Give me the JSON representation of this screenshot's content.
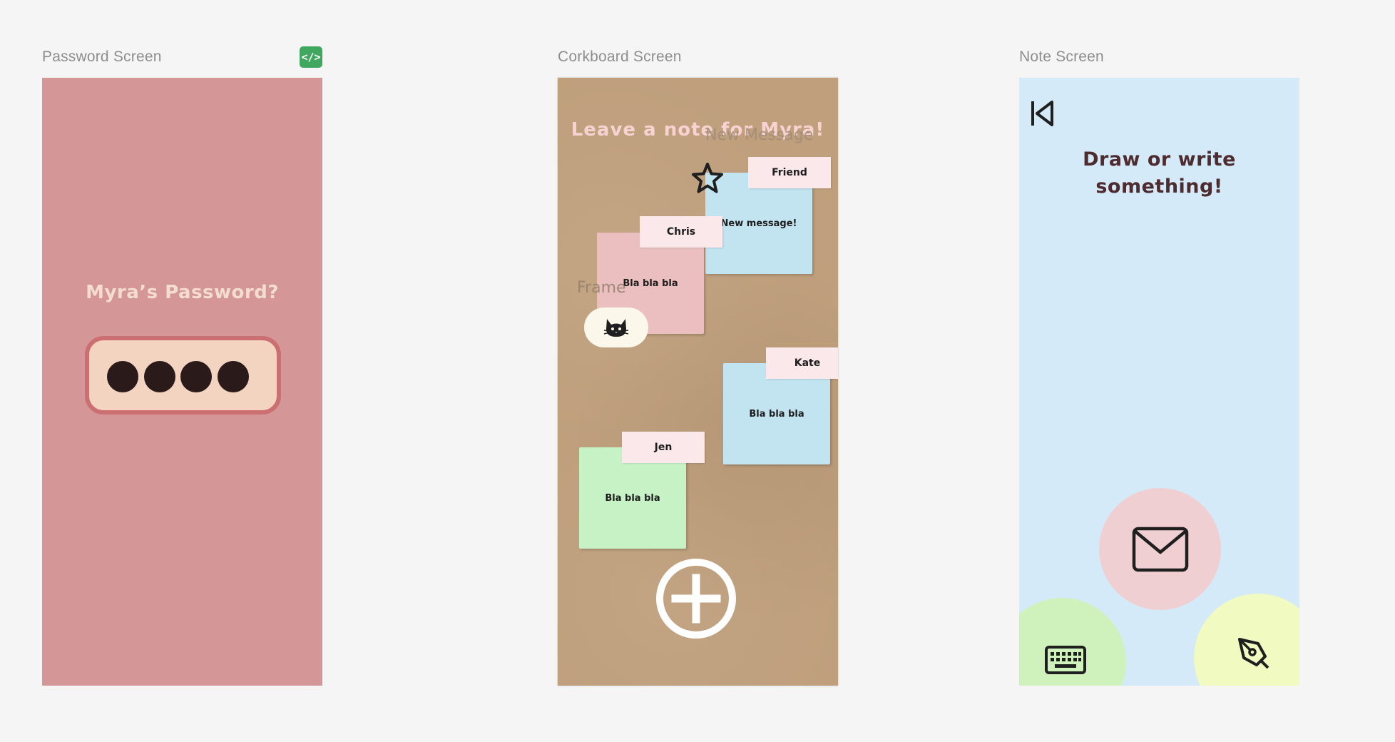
{
  "frames": {
    "password": {
      "label": "Password Screen",
      "title": "Myra’s Password?",
      "dot_count": 4
    },
    "corkboard": {
      "label": "Corkboard Screen",
      "title": "Leave a note for Myra!",
      "new_message_layer": "New Message",
      "frame_layer": "Frame",
      "notes": [
        {
          "author": "Friend",
          "text": "New message!",
          "color": "#c2e3f0"
        },
        {
          "author": "Chris",
          "text": "Bla bla bla",
          "color": "#ebbfc0"
        },
        {
          "author": "Kate",
          "text": "Bla bla bla",
          "color": "#c2e3f0"
        },
        {
          "author": "Jen",
          "text": "Bla bla bla",
          "color": "#c7f2c6"
        }
      ]
    },
    "note": {
      "label": "Note Screen",
      "title_line1": "Draw or write",
      "title_line2": "something!"
    }
  },
  "icons": [
    "code-icon",
    "star-icon",
    "cat-icon",
    "add-icon",
    "back-icon",
    "envelope-icon",
    "keyboard-icon",
    "pen-icon"
  ],
  "colors": {
    "password_bg": "#d49696",
    "cork_bg": "#bf9f7c",
    "note_bg": "#d4eaf8",
    "code_badge": "#3fa75e"
  }
}
